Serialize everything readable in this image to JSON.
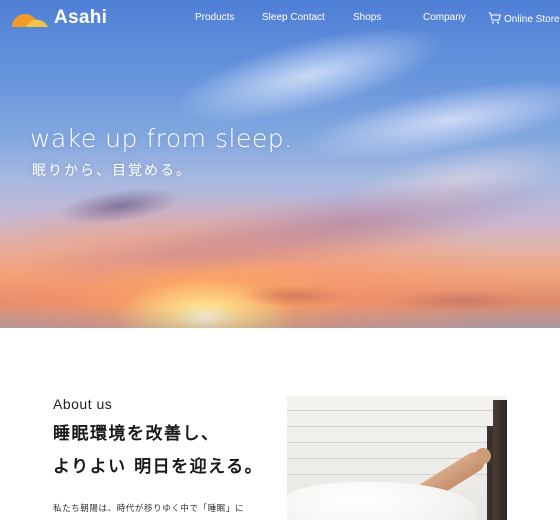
{
  "header": {
    "logo_text": "Asahi",
    "nav": [
      {
        "label": "Products"
      },
      {
        "label": "Sleep Contact"
      },
      {
        "label": "Shops"
      },
      {
        "label": "Company"
      },
      {
        "label": "Online Store",
        "icon": "cart-icon"
      }
    ]
  },
  "hero": {
    "tagline": "wake up from sleep.",
    "tagline_jp": "眠りから、目覚める。"
  },
  "about": {
    "label": "About us",
    "heading_line1": "睡眠環境を改善し、",
    "heading_line2": "よりよい 明日を迎える。",
    "body": "私たち朝陽は、時代が移りゆく中で「睡眠」に"
  },
  "colors": {
    "logo_orange": "#f39a2b",
    "logo_yellow": "#f7c548",
    "text_white": "#ffffff",
    "text_dark": "#222222"
  }
}
